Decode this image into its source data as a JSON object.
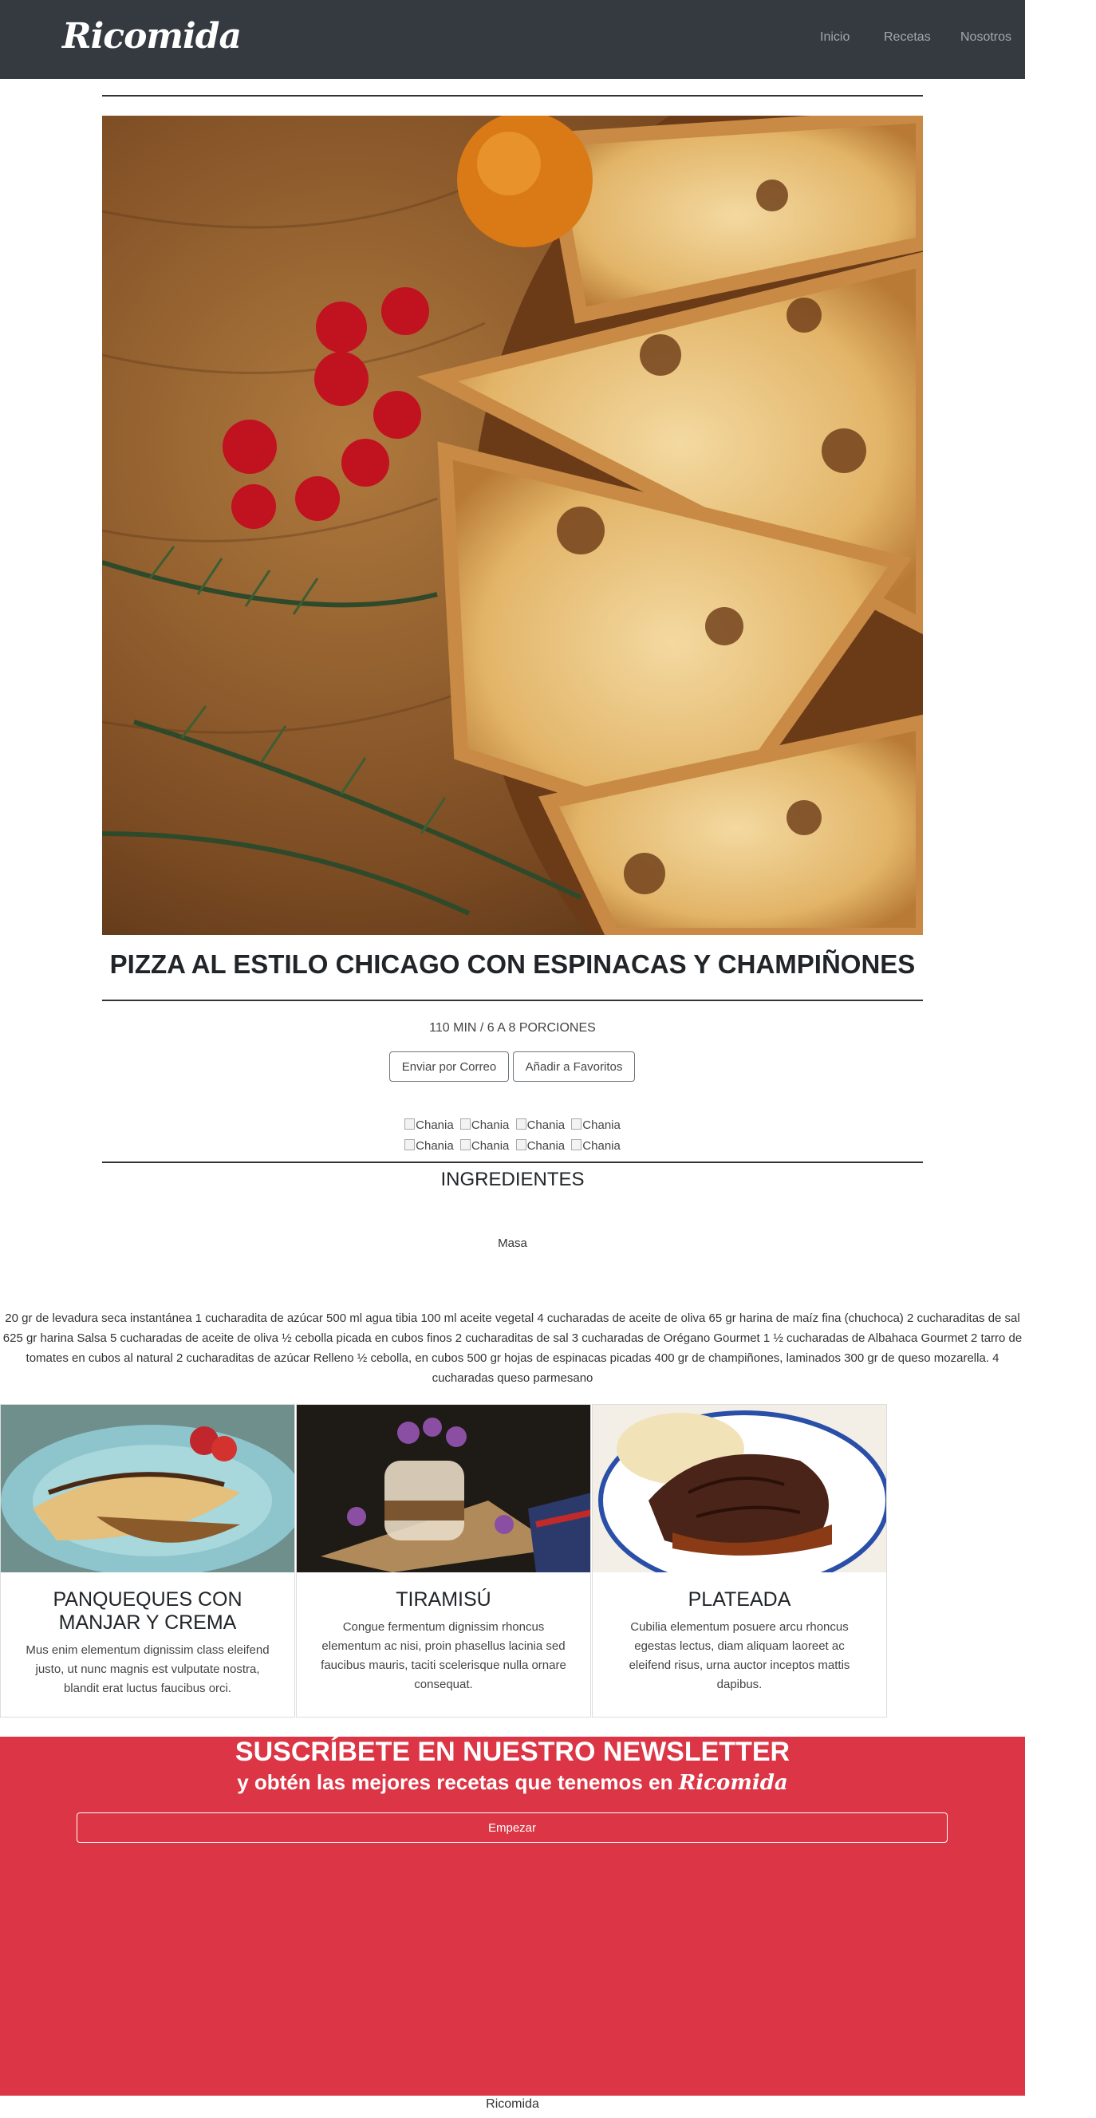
{
  "navbar": {
    "brand": "Ricomida",
    "links": [
      "Inicio",
      "Recetas",
      "Nosotros"
    ]
  },
  "recipe": {
    "title": "PIZZA AL ESTILO CHICAGO CON ESPINACAS Y CHAMPIÑONES",
    "meta": "110 MIN / 6 A 8 PORCIONES",
    "buttons": {
      "email": "Enviar por Correo",
      "favorites": "Añadir a Favoritos"
    },
    "thumb_alt": "Chania",
    "ingredients_heading": "INGREDIENTES",
    "section": "Masa",
    "ingredients_text": "20 gr de levadura seca instantánea 1 cucharadita de azúcar 500 ml agua tibia 100 ml aceite vegetal 4 cucharadas de aceite de oliva 65 gr harina de maíz fina (chuchoca) 2 cucharaditas de sal 625 gr harina Salsa 5 cucharadas de aceite de oliva ½ cebolla picada en cubos finos 2 cucharaditas de sal 3 cucharadas de Orégano Gourmet 1 ½ cucharadas de Albahaca Gourmet 2 tarro de tomates en cubos al natural 2 cucharaditas de azúcar Relleno ½ cebolla, en cubos 500 gr hojas de espinacas picadas 400 gr de champiñones, laminados 300 gr de queso mozarella. 4 cucharadas queso parmesano"
  },
  "cards": [
    {
      "title": "PANQUEQUES CON MANJAR Y CREMA",
      "text": "Mus enim elementum dignissim class eleifend justo, ut nunc magnis est vulputate nostra, blandit erat luctus faucibus orci."
    },
    {
      "title": "TIRAMISÚ",
      "text": "Congue fermentum dignissim rhoncus elementum ac nisi, proin phasellus lacinia sed faucibus mauris, taciti scelerisque nulla ornare consequat."
    },
    {
      "title": "PLATEADA",
      "text": "Cubilia elementum posuere arcu rhoncus egestas lectus, diam aliquam laoreet ac eleifend risus, urna auctor inceptos mattis dapibus."
    }
  ],
  "newsletter": {
    "title": "SUSCRÍBETE EN NUESTRO NEWSLETTER",
    "subtitle": "y obtén las mejores recetas que tenemos en",
    "brand": "Ricomida",
    "button": "Empezar"
  },
  "footer": {
    "text": "Ricomida"
  },
  "colors": {
    "navbar": "#343a40",
    "accent": "#dc3545"
  }
}
